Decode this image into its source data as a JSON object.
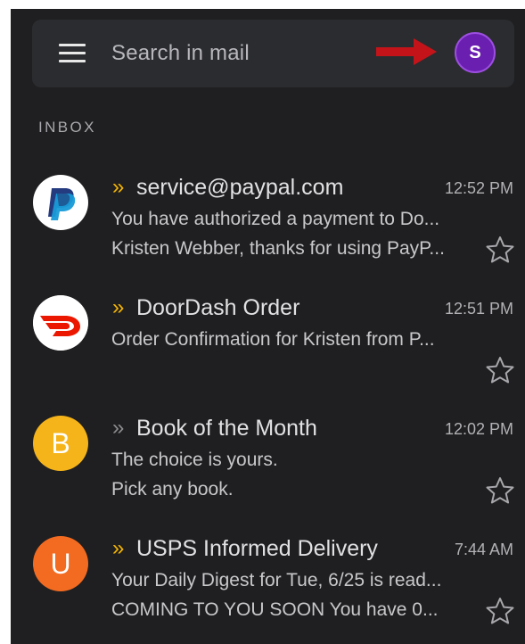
{
  "search": {
    "placeholder": "Search in mail"
  },
  "account": {
    "initial": "S",
    "color": "#6a1fb0"
  },
  "annotation": {
    "arrow_color": "#c4141a"
  },
  "inbox": {
    "label": "INBOX",
    "emails": [
      {
        "sender": "service@paypal.com",
        "time": "12:52 PM",
        "line1": "You have authorized a payment to Do...",
        "line2": "Kristen Webber, thanks for using PayP...",
        "avatar": "paypal-logo",
        "important": true
      },
      {
        "sender": "DoorDash Order",
        "time": "12:51 PM",
        "line1": "Order Confirmation for Kristen from P...",
        "line2": "",
        "avatar": "doordash-logo",
        "important": true
      },
      {
        "sender": "Book of the Month",
        "time": "12:02 PM",
        "line1": "The choice is yours.",
        "line2": "Pick any book.",
        "avatar_letter": "B",
        "avatar_color": "#f5b41a",
        "important": false
      },
      {
        "sender": "USPS Informed Delivery",
        "time": "7:44 AM",
        "line1": "Your Daily Digest for Tue, 6/25 is read...",
        "line2": "COMING TO YOU SOON You have 0...",
        "avatar_letter": "U",
        "avatar_color": "#f26b21",
        "important": true
      }
    ]
  },
  "colors": {
    "importance_on": "#f4b400",
    "importance_off": "#8c8c90",
    "background": "#1f1f21"
  }
}
